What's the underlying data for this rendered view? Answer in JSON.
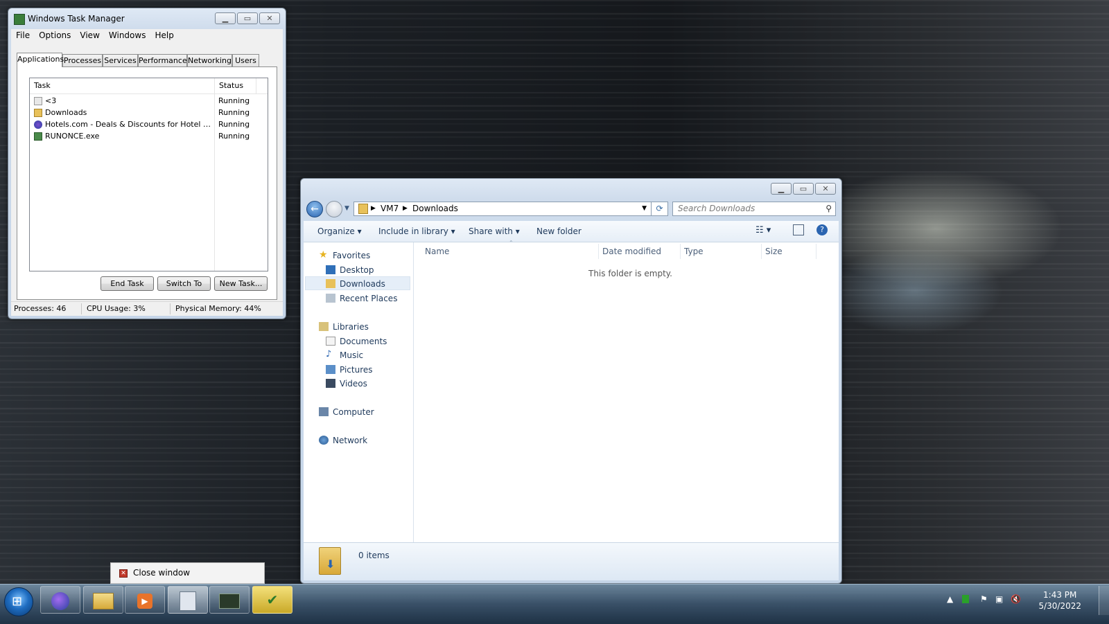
{
  "task_manager": {
    "title": "Windows Task Manager",
    "menu": [
      "File",
      "Options",
      "View",
      "Windows",
      "Help"
    ],
    "tabs": [
      "Applications",
      "Processes",
      "Services",
      "Performance",
      "Networking",
      "Users"
    ],
    "columns": {
      "task": "Task",
      "status": "Status"
    },
    "rows": [
      {
        "task": "<3",
        "status": "Running"
      },
      {
        "task": "Downloads",
        "status": "Running"
      },
      {
        "task": "Hotels.com - Deals & Discounts for Hotel Reserv...",
        "status": "Running"
      },
      {
        "task": "RUNONCE.exe",
        "status": "Running"
      }
    ],
    "buttons": {
      "end_task": "End Task",
      "switch_to": "Switch To",
      "new_task": "New Task..."
    },
    "status": {
      "processes": "Processes: 46",
      "cpu": "CPU Usage: 3%",
      "memory": "Physical Memory: 44%"
    }
  },
  "explorer": {
    "breadcrumb": [
      "VM7",
      "Downloads"
    ],
    "search_placeholder": "Search Downloads",
    "commands": {
      "organize": "Organize",
      "include": "Include in library",
      "share": "Share with",
      "new_folder": "New folder"
    },
    "nav": {
      "favorites": "Favorites",
      "desktop": "Desktop",
      "downloads": "Downloads",
      "recent": "Recent Places",
      "libraries": "Libraries",
      "documents": "Documents",
      "music": "Music",
      "pictures": "Pictures",
      "videos": "Videos",
      "computer": "Computer",
      "network": "Network"
    },
    "columns": {
      "name": "Name",
      "date": "Date modified",
      "type": "Type",
      "size": "Size"
    },
    "empty_text": "This folder is empty.",
    "item_count": "0 items"
  },
  "jumplist": {
    "close": "Close window"
  },
  "taskbar": {
    "time": "1:43 PM",
    "date": "5/30/2022"
  }
}
